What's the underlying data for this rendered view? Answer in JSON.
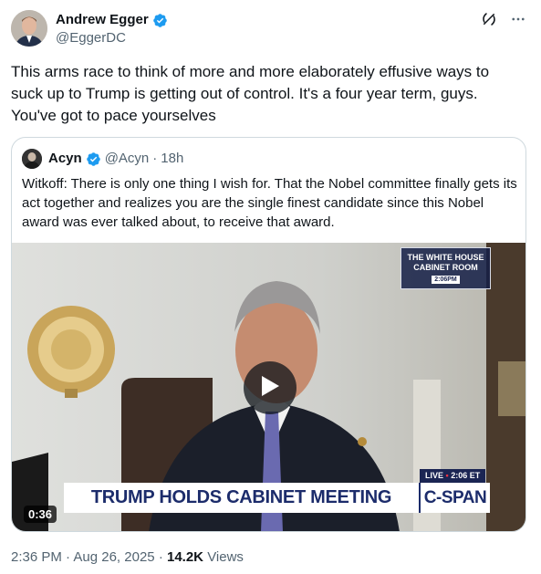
{
  "author": {
    "name": "Andrew Egger",
    "handle": "@EggerDC",
    "verified_color": "#1d9bf0"
  },
  "post": {
    "text": "This arms race to think of more and more elaborately effusive ways to suck up to Trump is getting out of control. It's a four year term, guys. You've got to pace yourselves"
  },
  "quoted": {
    "name": "Acyn",
    "handle": "@Acyn",
    "separator": "·",
    "time": "18h",
    "text": "Witkoff: There is only one thing I wish for. That the Nobel committee finally gets its act together and realizes you are the single finest candidate since this Nobel award was ever talked about, to receive that award.",
    "video": {
      "duration": "0:36",
      "location_line1": "THE WHITE HOUSE",
      "location_line2": "CABINET ROOM",
      "clock": "2:06PM",
      "live_label": "LIVE",
      "live_dot": "•",
      "live_time": "2:06 ET",
      "banner": "TRUMP HOLDS CABINET MEETING",
      "network": "C-SPAN"
    }
  },
  "footer": {
    "time": "2:36 PM",
    "separator1": "·",
    "date": "Aug 26, 2025",
    "separator2": "·",
    "views_count": "14.2K",
    "views_label": "Views"
  },
  "icons": {
    "grok": "grok-icon",
    "more": "more-icon"
  }
}
